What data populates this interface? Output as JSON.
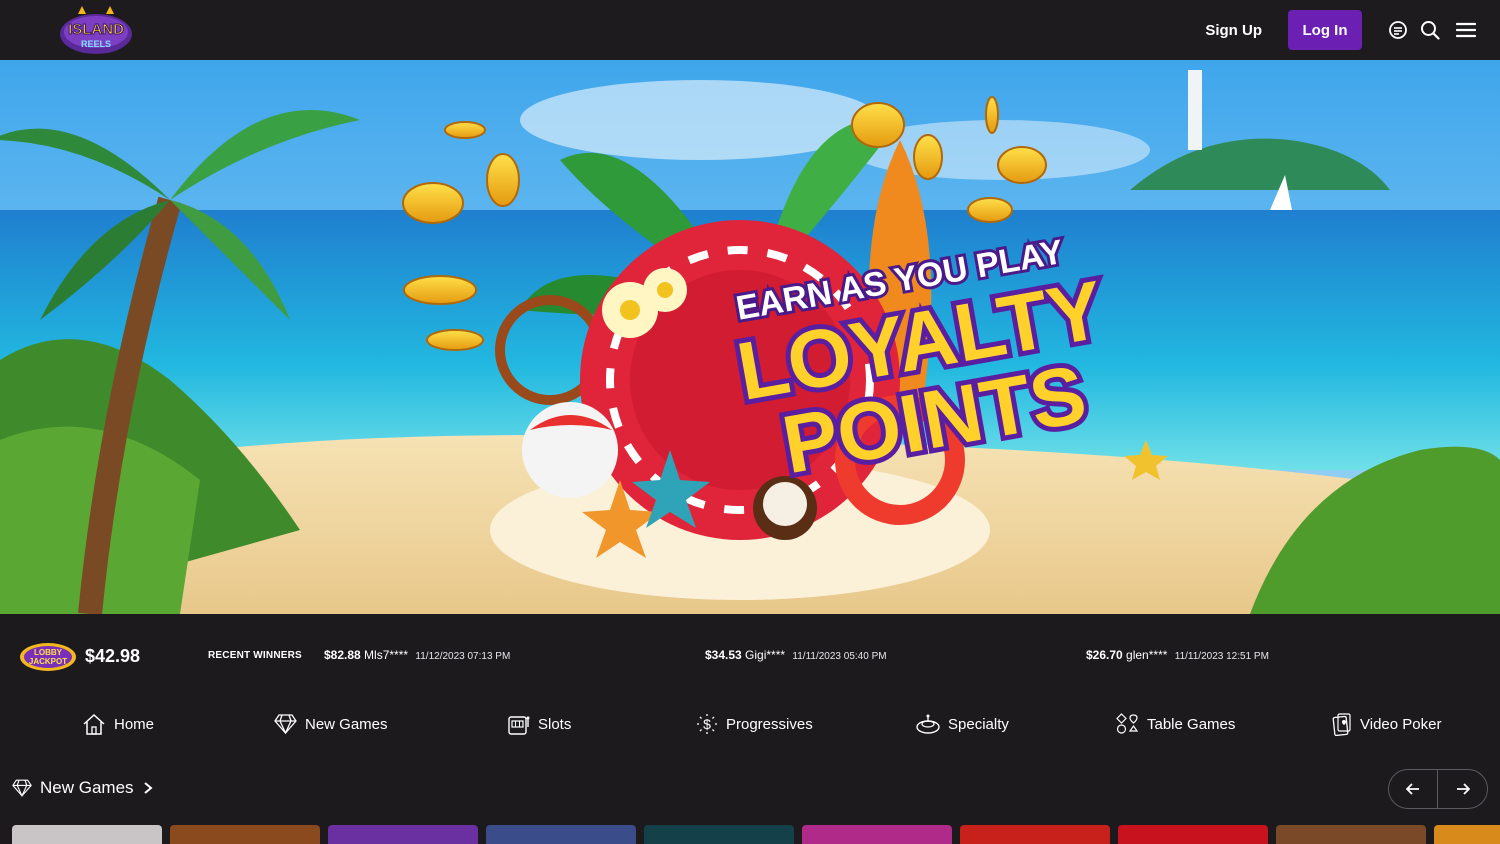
{
  "header": {
    "logo_text": "ISLAND REELS",
    "signup_label": "Sign Up",
    "login_label": "Log In",
    "icons": [
      "chat-icon",
      "search-icon",
      "menu-icon"
    ]
  },
  "hero": {
    "headline_top": "EARN AS YOU PLAY",
    "headline_main_1": "LOYALTY",
    "headline_main_2": "POINTS"
  },
  "jackpot": {
    "logo_text": "LOBBY JACKPOT",
    "amount": "$42.98"
  },
  "recent_winners": {
    "label": "RECENT WINNERS",
    "items": [
      {
        "amount": "$82.88",
        "user": "Mls7****",
        "datetime": "11/12/2023 07:13 PM"
      },
      {
        "amount": "$34.53",
        "user": "Gigi****",
        "datetime": "11/11/2023 05:40 PM"
      },
      {
        "amount": "$26.70",
        "user": "glen****",
        "datetime": "11/11/2023 12:51 PM"
      }
    ]
  },
  "categories": [
    {
      "label": "Home",
      "icon": "home-icon"
    },
    {
      "label": "New Games",
      "icon": "diamond-icon"
    },
    {
      "label": "Slots",
      "icon": "slot-machine-icon"
    },
    {
      "label": "Progressives",
      "icon": "dollar-burst-icon"
    },
    {
      "label": "Specialty",
      "icon": "specialty-icon"
    },
    {
      "label": "Table Games",
      "icon": "card-suits-icon"
    },
    {
      "label": "Video Poker",
      "icon": "poker-card-icon"
    }
  ],
  "new_games": {
    "title": "New Games",
    "tile_colors": [
      "#c9c5c6",
      "#8a4a1e",
      "#6a2fa0",
      "#3a4c8a",
      "#14404a",
      "#b02a8a",
      "#c8201a",
      "#c8121e",
      "#7a4a28",
      "#d88a1a"
    ]
  },
  "colors": {
    "accent": "#6b1fb3",
    "background": "#1c1a1d"
  }
}
